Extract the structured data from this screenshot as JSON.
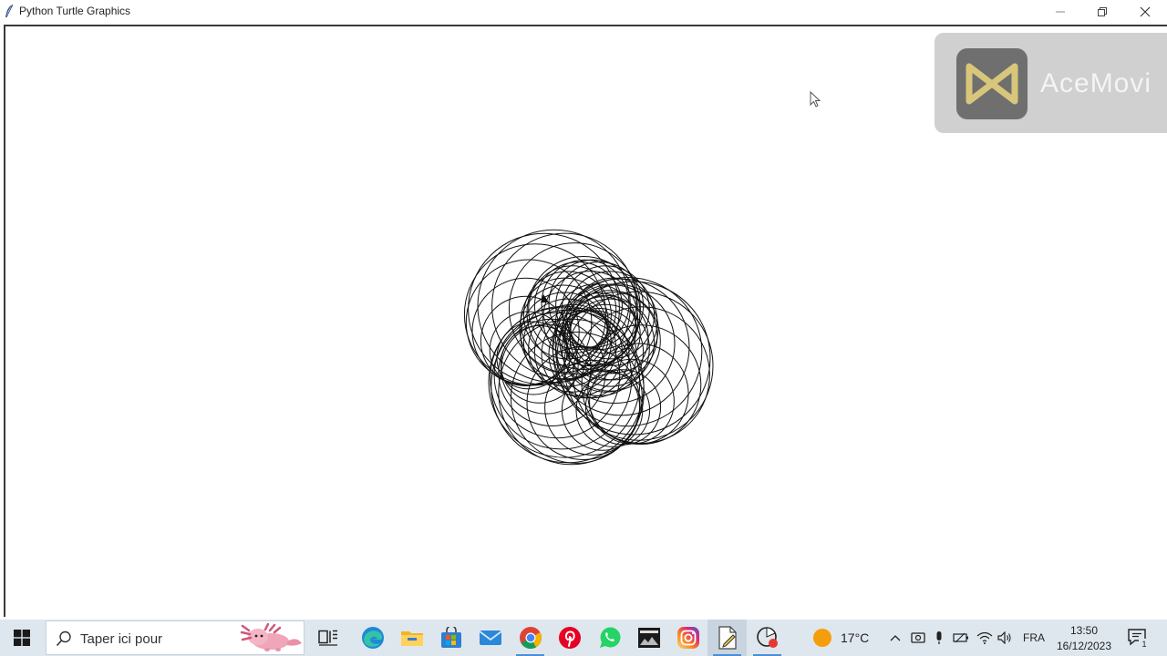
{
  "window": {
    "title": "Python Turtle Graphics"
  },
  "watermark": {
    "brand": "AceMovi"
  },
  "taskbar": {
    "search_placeholder": "Taper ici pour",
    "apps": [
      {
        "name": "task-view-icon"
      },
      {
        "name": "edge-icon"
      },
      {
        "name": "file-explorer-icon"
      },
      {
        "name": "microsoft-store-icon"
      },
      {
        "name": "mail-icon"
      },
      {
        "name": "chrome-icon"
      },
      {
        "name": "pinterest-icon"
      },
      {
        "name": "whatsapp-icon"
      },
      {
        "name": "photo-app-icon"
      },
      {
        "name": "instagram-icon"
      },
      {
        "name": "editor-icon"
      },
      {
        "name": "recorder-icon"
      }
    ],
    "weather": "17°C",
    "language": "FRA",
    "time": "13:50",
    "date": "16/12/2023",
    "notification_count": "1"
  },
  "colors": {
    "taskbar_bg": "#dfe7ee",
    "accent": "#4b8fd6",
    "stroke": "#111111"
  }
}
